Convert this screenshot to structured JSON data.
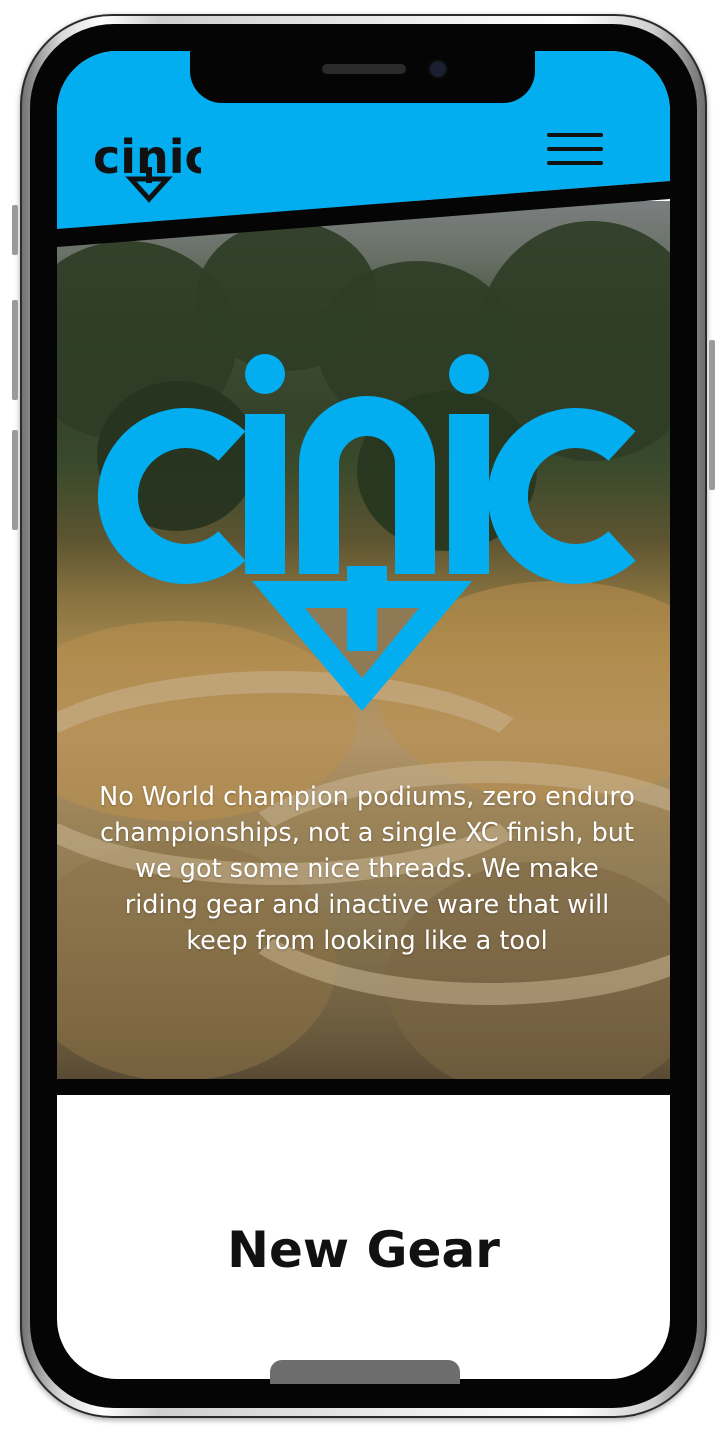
{
  "brand": {
    "name": "cinic",
    "accent_color": "#02AEEF",
    "logo_icon": "cinic-logo-down-arrow"
  },
  "header": {
    "menu_icon": "hamburger-menu-icon"
  },
  "hero": {
    "description": "No World champion podiums, zero enduro championships, not a single XC finish, but we got some nice threads. We make riding gear and inactive ware that will keep from looking like a tool"
  },
  "sections": {
    "new_gear_title": "New Gear"
  }
}
